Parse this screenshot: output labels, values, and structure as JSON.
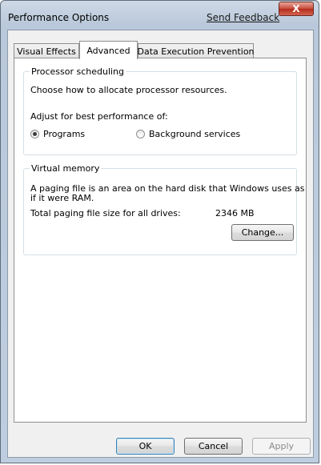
{
  "window": {
    "title": "Performance Options",
    "feedback_link": "Send Feedback",
    "close_glyph": "X"
  },
  "tabs": [
    {
      "label": "Visual Effects",
      "active": false
    },
    {
      "label": "Advanced",
      "active": true
    },
    {
      "label": "Data Execution Prevention",
      "active": false
    }
  ],
  "processor": {
    "legend": "Processor scheduling",
    "description": "Choose how to allocate processor resources.",
    "adjust_label": "Adjust for best performance of:",
    "options": [
      {
        "label": "Programs",
        "selected": true
      },
      {
        "label": "Background services",
        "selected": false
      }
    ]
  },
  "virtual_memory": {
    "legend": "Virtual memory",
    "description_line1": "A paging file is an area on the hard disk that Windows uses as",
    "description_line2": "if it were RAM.",
    "total_label": "Total paging file size for all drives:",
    "total_value": "2346 MB",
    "change_button": "Change..."
  },
  "footer": {
    "ok_button": "OK",
    "cancel_button": "Cancel",
    "apply_button": "Apply"
  },
  "colors": {
    "frame_border": "#5f6c7b",
    "close_button": "#c7493a",
    "group_border": "#d5dfe5",
    "default_button_border": "#3c7fb1"
  }
}
